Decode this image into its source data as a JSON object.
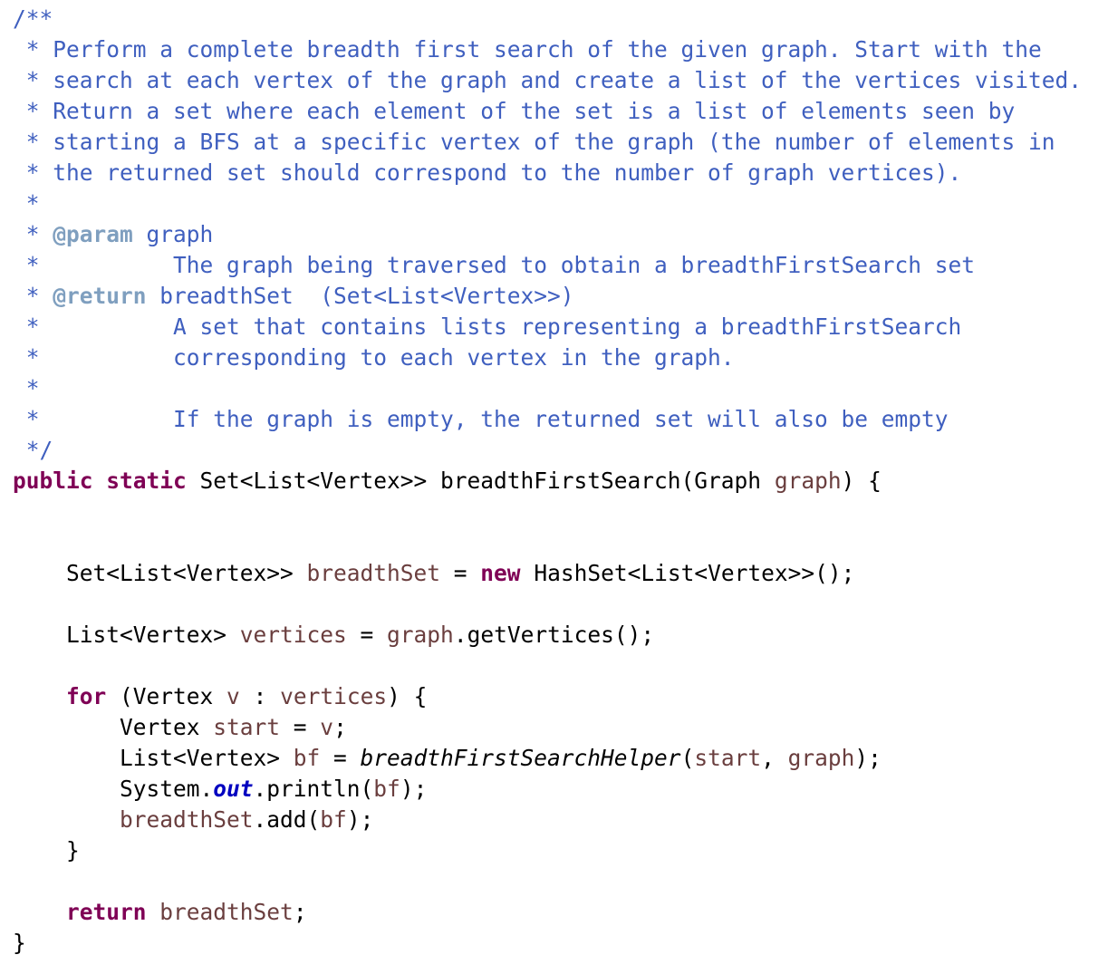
{
  "colors": {
    "background": "#ffffff",
    "javadoc_comment": "#3f5fbf",
    "javadoc_tag": "#7f9fbf",
    "keyword": "#7f0055",
    "local_variable": "#6a3e3e",
    "static_field": "#0000c0",
    "default_text": "#000000"
  },
  "lines": [
    [
      {
        "t": "/**",
        "c": "comment"
      }
    ],
    [
      {
        "t": " * Perform a complete breadth first search of the given graph. Start with the",
        "c": "comment"
      }
    ],
    [
      {
        "t": " * search at each vertex of the graph and create a list of the vertices visited.",
        "c": "comment"
      }
    ],
    [
      {
        "t": " * Return a set where each element of the set is a list of elements seen by",
        "c": "comment"
      }
    ],
    [
      {
        "t": " * starting a BFS at a specific vertex of the graph (the number of elements in",
        "c": "comment"
      }
    ],
    [
      {
        "t": " * the returned set should correspond to the number of graph vertices).",
        "c": "comment"
      }
    ],
    [
      {
        "t": " *",
        "c": "comment"
      }
    ],
    [
      {
        "t": " * ",
        "c": "comment"
      },
      {
        "t": "@param",
        "c": "tag"
      },
      {
        "t": " graph",
        "c": "comment"
      }
    ],
    [
      {
        "t": " *          The graph being traversed to obtain a breadthFirstSearch set",
        "c": "comment"
      }
    ],
    [
      {
        "t": " * ",
        "c": "comment"
      },
      {
        "t": "@return",
        "c": "tag"
      },
      {
        "t": " breadthSet  (Set<List<Vertex>>)",
        "c": "comment"
      }
    ],
    [
      {
        "t": " *          A set that contains lists representing a breadthFirstSearch",
        "c": "comment"
      }
    ],
    [
      {
        "t": " *          corresponding to each vertex in the graph.",
        "c": "comment"
      }
    ],
    [
      {
        "t": " *",
        "c": "comment"
      }
    ],
    [
      {
        "t": " *          If the graph is empty, the returned set will also be empty",
        "c": "comment"
      }
    ],
    [
      {
        "t": " */",
        "c": "comment"
      }
    ],
    [
      {
        "t": "public",
        "c": "kw"
      },
      {
        "t": " ",
        "c": "plain"
      },
      {
        "t": "static",
        "c": "kw"
      },
      {
        "t": " Set<List<Vertex>> breadthFirstSearch(Graph ",
        "c": "plain"
      },
      {
        "t": "graph",
        "c": "var"
      },
      {
        "t": ") {",
        "c": "plain"
      }
    ],
    [],
    [],
    [
      {
        "t": "    Set<List<Vertex>> ",
        "c": "plain"
      },
      {
        "t": "breadthSet",
        "c": "var"
      },
      {
        "t": " = ",
        "c": "plain"
      },
      {
        "t": "new",
        "c": "kw"
      },
      {
        "t": " HashSet<List<Vertex>>();",
        "c": "plain"
      }
    ],
    [],
    [
      {
        "t": "    List<Vertex> ",
        "c": "plain"
      },
      {
        "t": "vertices",
        "c": "var"
      },
      {
        "t": " = ",
        "c": "plain"
      },
      {
        "t": "graph",
        "c": "var"
      },
      {
        "t": ".getVertices();",
        "c": "plain"
      }
    ],
    [],
    [
      {
        "t": "    ",
        "c": "plain"
      },
      {
        "t": "for",
        "c": "kw"
      },
      {
        "t": " (Vertex ",
        "c": "plain"
      },
      {
        "t": "v",
        "c": "var"
      },
      {
        "t": " : ",
        "c": "plain"
      },
      {
        "t": "vertices",
        "c": "var"
      },
      {
        "t": ") {",
        "c": "plain"
      }
    ],
    [
      {
        "t": "        Vertex ",
        "c": "plain"
      },
      {
        "t": "start",
        "c": "var"
      },
      {
        "t": " = ",
        "c": "plain"
      },
      {
        "t": "v",
        "c": "var"
      },
      {
        "t": ";",
        "c": "plain"
      }
    ],
    [
      {
        "t": "        List<Vertex> ",
        "c": "plain"
      },
      {
        "t": "bf",
        "c": "var"
      },
      {
        "t": " = ",
        "c": "plain"
      },
      {
        "t": "breadthFirstSearchHelper",
        "c": "static"
      },
      {
        "t": "(",
        "c": "plain"
      },
      {
        "t": "start",
        "c": "var"
      },
      {
        "t": ", ",
        "c": "plain"
      },
      {
        "t": "graph",
        "c": "var"
      },
      {
        "t": ");",
        "c": "plain"
      }
    ],
    [
      {
        "t": "        System.",
        "c": "plain"
      },
      {
        "t": "out",
        "c": "field"
      },
      {
        "t": ".println(",
        "c": "plain"
      },
      {
        "t": "bf",
        "c": "var"
      },
      {
        "t": ");",
        "c": "plain"
      }
    ],
    [
      {
        "t": "        ",
        "c": "plain"
      },
      {
        "t": "breadthSet",
        "c": "var"
      },
      {
        "t": ".add(",
        "c": "plain"
      },
      {
        "t": "bf",
        "c": "var"
      },
      {
        "t": ");",
        "c": "plain"
      }
    ],
    [
      {
        "t": "    }",
        "c": "plain"
      }
    ],
    [],
    [
      {
        "t": "    ",
        "c": "plain"
      },
      {
        "t": "return",
        "c": "kw"
      },
      {
        "t": " ",
        "c": "plain"
      },
      {
        "t": "breadthSet",
        "c": "var"
      },
      {
        "t": ";",
        "c": "plain"
      }
    ],
    [
      {
        "t": "}",
        "c": "plain"
      }
    ]
  ]
}
